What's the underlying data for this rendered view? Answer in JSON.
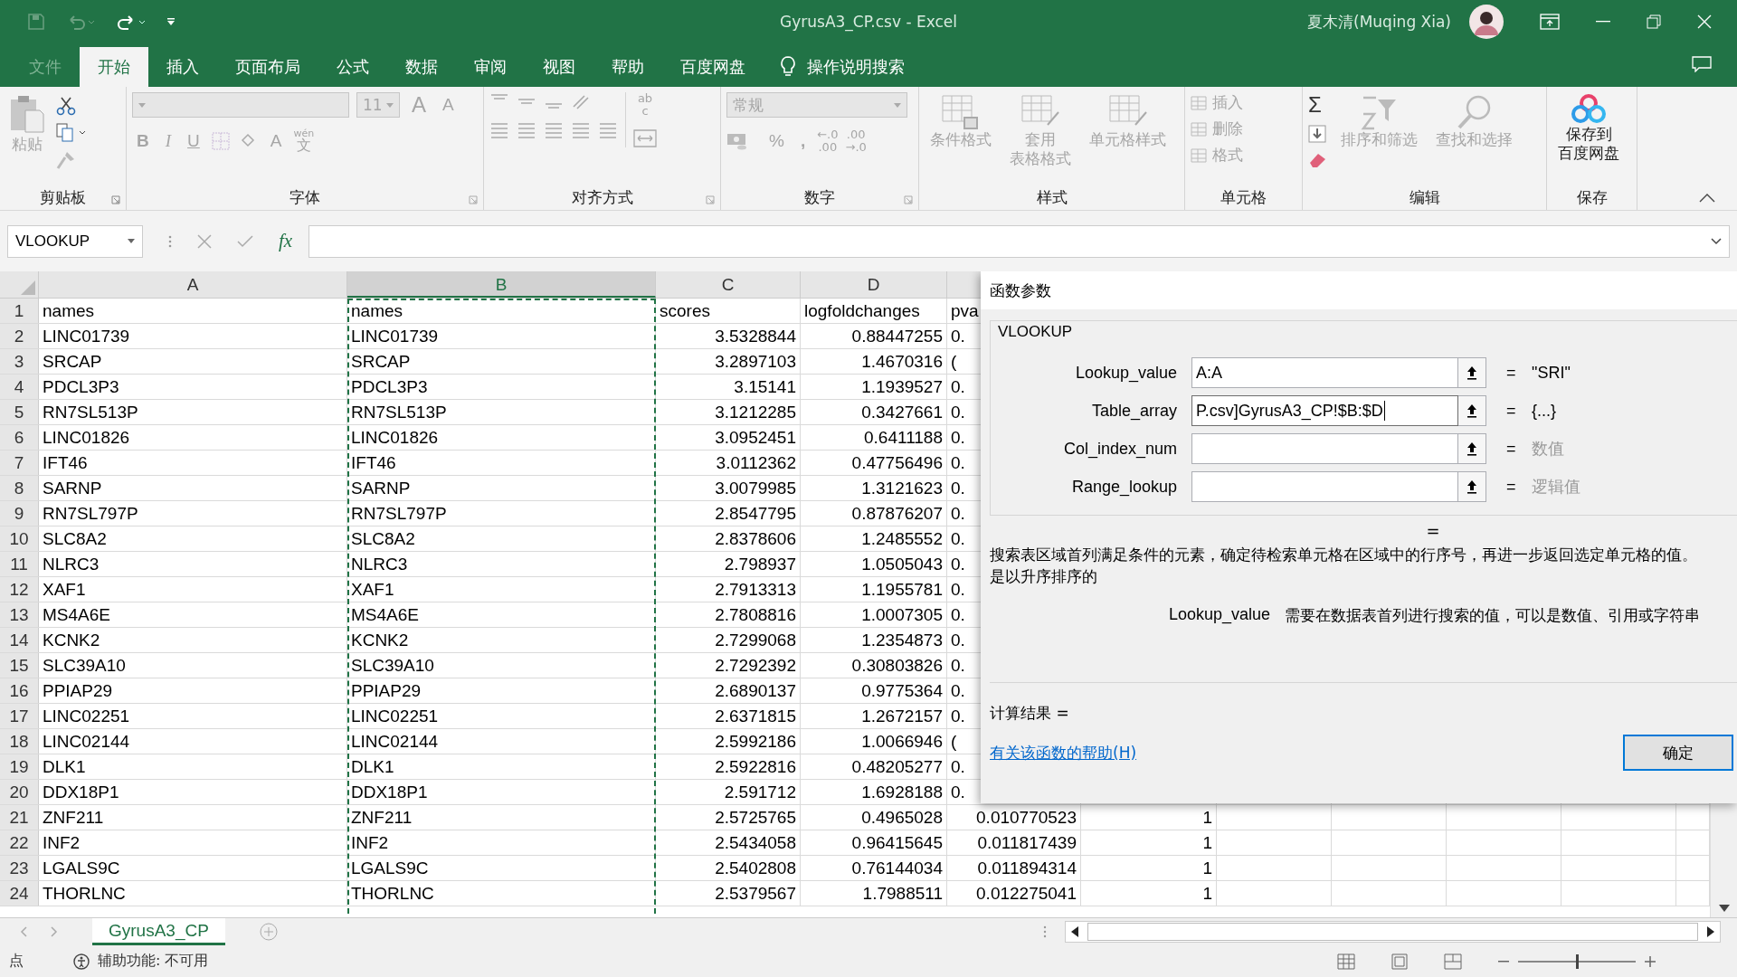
{
  "title_bar": {
    "title": "GyrusA3_CP.csv  -  Excel",
    "user": "夏木清(Muqing Xia)"
  },
  "tabs": [
    {
      "label": "文件",
      "kind": "file",
      "selected": false
    },
    {
      "label": "开始",
      "kind": "tab",
      "selected": true
    },
    {
      "label": "插入",
      "kind": "tab",
      "selected": false
    },
    {
      "label": "页面布局",
      "kind": "tab",
      "selected": false
    },
    {
      "label": "公式",
      "kind": "tab",
      "selected": false
    },
    {
      "label": "数据",
      "kind": "tab",
      "selected": false
    },
    {
      "label": "审阅",
      "kind": "tab",
      "selected": false
    },
    {
      "label": "视图",
      "kind": "tab",
      "selected": false
    },
    {
      "label": "帮助",
      "kind": "tab",
      "selected": false
    },
    {
      "label": "百度网盘",
      "kind": "tab",
      "selected": false
    }
  ],
  "tell_me": "操作说明搜索",
  "ribbon": {
    "clipboard": {
      "label": "剪贴板",
      "paste": {
        "label": "粘贴",
        "disabled": true
      }
    },
    "font": {
      "label": "字体",
      "disabled": true,
      "size": "11",
      "grow": "A",
      "shrink": "A",
      "bold": "B",
      "italic": "I",
      "underline": "U",
      "font_color_letter": "A",
      "phonetic": "wén",
      "phonetic_char": "文"
    },
    "alignment": {
      "label": "对齐方式",
      "disabled": true,
      "wrap": "ab",
      "wrap_c": "c"
    },
    "number": {
      "label": "数字",
      "disabled": true,
      "format": "常规",
      "percent": "%",
      "comma": ",",
      "dec_inc": [
        "←.0",
        ".00"
      ],
      "dec_dec": [
        ".00",
        "→.0"
      ]
    },
    "styles": {
      "label": "样式",
      "disabled": true,
      "items": [
        {
          "lines": [
            "条件格式"
          ]
        },
        {
          "lines": [
            "套用",
            "表格格式"
          ]
        },
        {
          "lines": [
            "单元格样式"
          ]
        }
      ]
    },
    "cells": {
      "label": "单元格",
      "disabled": true,
      "items": [
        "插入",
        "删除",
        "格式"
      ]
    },
    "editing": {
      "label": "编辑",
      "sum": "Σ",
      "items": [
        {
          "label": "排序和筛选",
          "disabled": true
        },
        {
          "label": "查找和选择",
          "disabled": true
        }
      ]
    },
    "save": {
      "label": "保存",
      "lines": [
        "保存到",
        "百度网盘"
      ]
    }
  },
  "formula_bar": {
    "name_box": "VLOOKUP",
    "fx": "fx"
  },
  "grid": {
    "columns": [
      {
        "label": "A",
        "selected": false
      },
      {
        "label": "B",
        "selected": true
      },
      {
        "label": "C",
        "selected": false
      },
      {
        "label": "D",
        "selected": false
      }
    ],
    "rows": [
      {
        "n": "1",
        "kind": "header",
        "cells": [
          "names",
          "names",
          "scores",
          "logfoldchanges",
          "pva"
        ]
      },
      {
        "n": "2",
        "kind": "partial",
        "cells": [
          "LINC01739",
          "LINC01739",
          "3.5328844",
          "0.88447255",
          "0."
        ]
      },
      {
        "n": "3",
        "kind": "partial",
        "cells": [
          "SRCAP",
          "SRCAP",
          "3.2897103",
          "1.4670316",
          "("
        ]
      },
      {
        "n": "4",
        "kind": "partial",
        "cells": [
          "PDCL3P3",
          "PDCL3P3",
          "3.15141",
          "1.1939527",
          "0."
        ]
      },
      {
        "n": "5",
        "kind": "partial",
        "cells": [
          "RN7SL513P",
          "RN7SL513P",
          "3.1212285",
          "0.3427661",
          "0."
        ]
      },
      {
        "n": "6",
        "kind": "partial",
        "cells": [
          "LINC01826",
          "LINC01826",
          "3.0952451",
          "0.6411188",
          "0."
        ]
      },
      {
        "n": "7",
        "kind": "partial",
        "cells": [
          "IFT46",
          "IFT46",
          "3.0112362",
          "0.47756496",
          "0."
        ]
      },
      {
        "n": "8",
        "kind": "partial",
        "cells": [
          "SARNP",
          "SARNP",
          "3.0079985",
          "1.3121623",
          "0."
        ]
      },
      {
        "n": "9",
        "kind": "partial",
        "cells": [
          "RN7SL797P",
          "RN7SL797P",
          "2.8547795",
          "0.87876207",
          "0."
        ]
      },
      {
        "n": "10",
        "kind": "partial",
        "cells": [
          "SLC8A2",
          "SLC8A2",
          "2.8378606",
          "1.2485552",
          "0."
        ]
      },
      {
        "n": "11",
        "kind": "partial",
        "cells": [
          "NLRC3",
          "NLRC3",
          "2.798937",
          "1.0505043",
          "0."
        ]
      },
      {
        "n": "12",
        "kind": "partial",
        "cells": [
          "XAF1",
          "XAF1",
          "2.7913313",
          "1.1955781",
          "0."
        ]
      },
      {
        "n": "13",
        "kind": "partial",
        "cells": [
          "MS4A6E",
          "MS4A6E",
          "2.7808816",
          "1.0007305",
          "0."
        ]
      },
      {
        "n": "14",
        "kind": "partial",
        "cells": [
          "KCNK2",
          "KCNK2",
          "2.7299068",
          "1.2354873",
          "0."
        ]
      },
      {
        "n": "15",
        "kind": "partial",
        "cells": [
          "SLC39A10",
          "SLC39A10",
          "2.7292392",
          "0.30803826",
          "0."
        ]
      },
      {
        "n": "16",
        "kind": "partial",
        "cells": [
          "PPIAP29",
          "PPIAP29",
          "2.6890137",
          "0.9775364",
          "0."
        ]
      },
      {
        "n": "17",
        "kind": "partial",
        "cells": [
          "LINC02251",
          "LINC02251",
          "2.6371815",
          "1.2672157",
          "0."
        ]
      },
      {
        "n": "18",
        "kind": "partial",
        "cells": [
          "LINC02144",
          "LINC02144",
          "2.5992186",
          "1.0066946",
          "("
        ]
      },
      {
        "n": "19",
        "kind": "partial",
        "cells": [
          "DLK1",
          "DLK1",
          "2.5922816",
          "0.48205277",
          "0."
        ]
      },
      {
        "n": "20",
        "kind": "partial",
        "cells": [
          "DDX18P1",
          "DDX18P1",
          "2.591712",
          "1.6928188",
          "0."
        ]
      },
      {
        "n": "21",
        "kind": "data",
        "cells": [
          "ZNF211",
          "ZNF211",
          "2.5725765",
          "0.4965028",
          "0.010770523",
          "1"
        ]
      },
      {
        "n": "22",
        "kind": "data",
        "cells": [
          "INF2",
          "INF2",
          "2.5434058",
          "0.96415645",
          "0.011817439",
          "1"
        ]
      },
      {
        "n": "23",
        "kind": "data",
        "cells": [
          "LGALS9C",
          "LGALS9C",
          "2.5402808",
          "0.76144034",
          "0.011894314",
          "1"
        ]
      },
      {
        "n": "24",
        "kind": "data",
        "cells": [
          "THORLNC",
          "THORLNC",
          "2.5379567",
          "1.7988511",
          "0.012275041",
          "1"
        ]
      }
    ]
  },
  "dialog": {
    "title": "函数参数",
    "function": "VLOOKUP",
    "args": [
      {
        "name": "Lookup_value",
        "value": "A:A",
        "focused": false,
        "equals": "=",
        "result": "\"SRI\"",
        "hint": false
      },
      {
        "name": "Table_array",
        "value": "P.csv]GyrusA3_CP!$B:$D",
        "focused": true,
        "equals": "=",
        "result": "{...}",
        "hint": false
      },
      {
        "name": "Col_index_num",
        "focused": false,
        "equals": "=",
        "result": "数值",
        "hint": true
      },
      {
        "name": "Range_lookup",
        "focused": false,
        "equals": "=",
        "result": "逻辑值",
        "hint": true
      }
    ],
    "total": "=",
    "description": [
      "搜索表区域首列满足条件的元素，确定待检索单元格在区域中的行序号，再进一步返回选定单元格的值。",
      "是以升序排序的"
    ],
    "arg_help": {
      "name": "Lookup_value",
      "text": "需要在数据表首列进行搜索的值，可以是数值、引用或字符串"
    },
    "result_label": "计算结果 =",
    "help_link": "有关该函数的帮助(H)",
    "ok": "确定"
  },
  "sheet_tabs": [
    {
      "label": "GyrusA3_CP",
      "selected": true
    }
  ],
  "status_bar": {
    "mode": "点",
    "accessibility": "辅助功能: 不可用",
    "zoom": {
      "level": 0.5
    }
  }
}
